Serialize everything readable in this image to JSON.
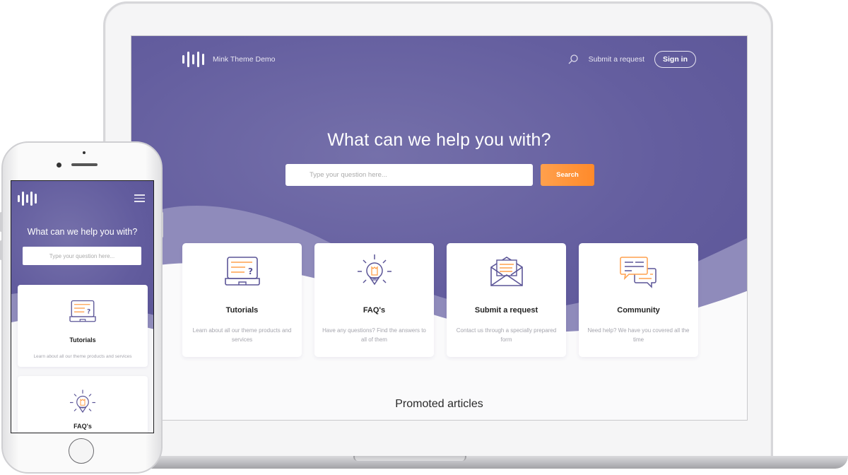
{
  "desktop": {
    "brand": "Mink Theme Demo",
    "nav": {
      "search_icon": "search-icon",
      "submit_request_label": "Submit a request",
      "sign_in_label": "Sign in"
    },
    "hero": {
      "title": "What can we help you with?",
      "search_placeholder": "Type your question here...",
      "search_button_label": "Search"
    },
    "cards": [
      {
        "icon": "laptop-question-icon",
        "title": "Tutorials",
        "description": "Learn about all our theme products and services"
      },
      {
        "icon": "lightbulb-icon",
        "title": "FAQ's",
        "description": "Have any questions? Find the answers to all of them"
      },
      {
        "icon": "envelope-icon",
        "title": "Submit a request",
        "description": "Contact us through a specially prepared form"
      },
      {
        "icon": "chat-bubbles-icon",
        "title": "Community",
        "description": "Need help? We have you covered all the time"
      }
    ],
    "section_title": "Promoted articles"
  },
  "mobile": {
    "menu_icon": "hamburger-icon",
    "hero": {
      "title": "What can we help you with?",
      "search_placeholder": "Type your question here..."
    },
    "cards": [
      {
        "icon": "laptop-question-icon",
        "title": "Tutorials",
        "description": "Learn about all our theme products and services"
      },
      {
        "icon": "lightbulb-icon",
        "title": "FAQ's"
      }
    ]
  },
  "colors": {
    "hero_purple": "#645e9f",
    "accent_orange": "#ff8f33",
    "icon_stroke": "#5b5597"
  }
}
